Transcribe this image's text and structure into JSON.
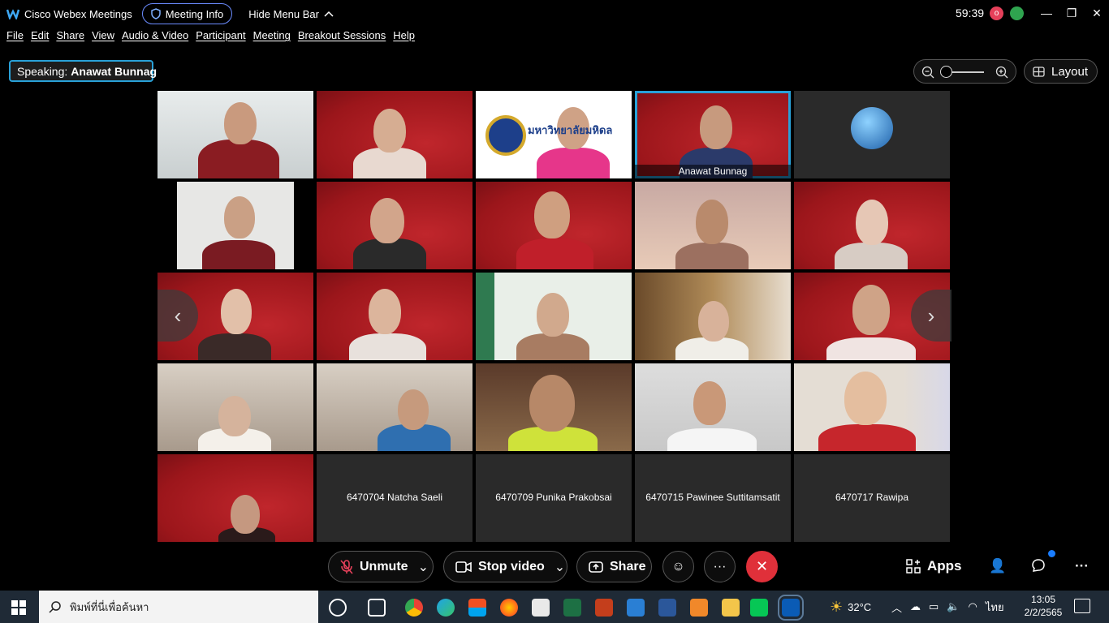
{
  "window": {
    "app_name": "Cisco Webex Meetings",
    "meeting_info_label": "Meeting Info",
    "hide_menu_label": "Hide Menu Bar",
    "timer": "59:39",
    "recording_badge": "o"
  },
  "menu": [
    "File",
    "Edit",
    "Share",
    "View",
    "Audio & Video",
    "Participant",
    "Meeting",
    "Breakout Sessions",
    "Help"
  ],
  "speaking": {
    "prefix": "Speaking:",
    "name": "Anawat Bunnag"
  },
  "layout_label": "Layout",
  "tiles": {
    "anawat_caption": "Anawat Bunnag",
    "logo_text": "มหาวิทยาลัยมหิดล",
    "natcha": "6470704 Natcha Saeli",
    "punika": "6470709 Punika Prakobsai",
    "pawinee": "6470715 Pawinee Suttitamsatit",
    "rawipa": "6470717 Rawipa"
  },
  "controls": {
    "unmute": "Unmute",
    "stop_video": "Stop video",
    "share": "Share",
    "apps": "Apps"
  },
  "taskbar": {
    "search_placeholder": "พิมพ์ที่นี่เพื่อค้นหา",
    "weather": "32°C",
    "language": "ไทย",
    "time": "13:05",
    "date": "2/2/2565"
  },
  "colors": {
    "accent": "#29a1d8",
    "end_call": "#e0303a",
    "stage_red": "#a8181e"
  }
}
